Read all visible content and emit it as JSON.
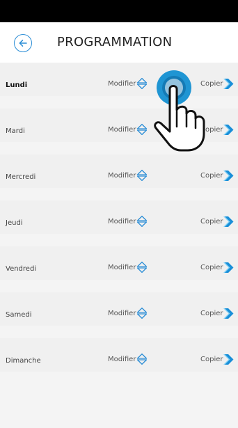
{
  "header": {
    "title": "PROGRAMMATION",
    "back_icon": "arrow-left-circle-icon"
  },
  "days": [
    {
      "name": "Lundi",
      "modify_label": "Modifier",
      "copy_label": "Copier",
      "active": true
    },
    {
      "name": "Mardi",
      "modify_label": "Modifier",
      "copy_label": "Copier",
      "active": false
    },
    {
      "name": "Mercredi",
      "modify_label": "Modifier",
      "copy_label": "Copier",
      "active": false
    },
    {
      "name": "Jeudi",
      "modify_label": "Modifier",
      "copy_label": "Copier",
      "active": false
    },
    {
      "name": "Vendredi",
      "modify_label": "Modifier",
      "copy_label": "Copier",
      "active": false
    },
    {
      "name": "Samedi",
      "modify_label": "Modifier",
      "copy_label": "Copier",
      "active": false
    },
    {
      "name": "Dimanche",
      "modify_label": "Modifier",
      "copy_label": "Copier",
      "active": false
    }
  ],
  "icons": {
    "modify": "expand-up-down-icon",
    "copy": "copy-arrow-icon",
    "overlay": "tap-hand-icon"
  },
  "colors": {
    "accent": "#2c8ed6",
    "copy_arrow": "#1a8fd8",
    "copy_shadow": "#7fd0f6",
    "row_background": "#f0f0f0",
    "list_background": "#f4f4f4",
    "status_bar": "#000000"
  }
}
